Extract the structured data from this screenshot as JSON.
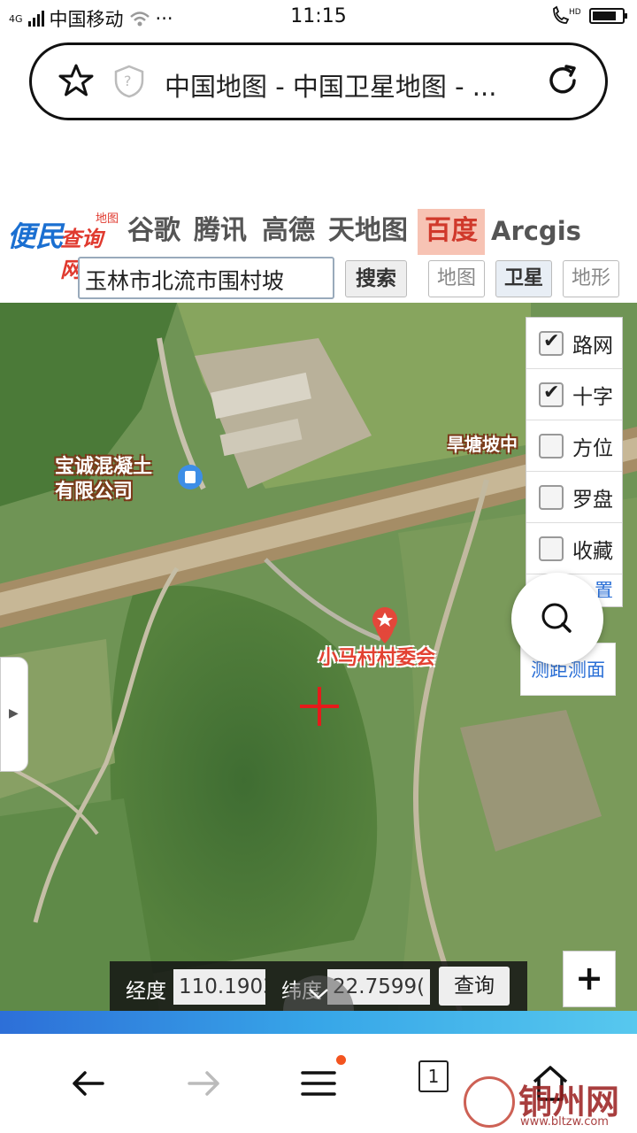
{
  "status_bar": {
    "network": "4G",
    "carrier": "中国移动",
    "more": "···",
    "time": "11:15",
    "hd": "HD",
    "battery_level": 0.8
  },
  "url_bar": {
    "title": "中国地图 - 中国卫星地图 - ..."
  },
  "site": {
    "logo_main": "便民",
    "logo_sub": "查询网",
    "logo_tag": "地图",
    "tabs": [
      "谷歌",
      "腾讯",
      "高德",
      "天地图",
      "百度",
      "Arcgis"
    ],
    "active_tab": "百度",
    "search_value": "玉林市北流市围村坡",
    "search_button": "搜索",
    "map_types": [
      "地图",
      "卫星",
      "地形"
    ],
    "active_map_type": "卫星"
  },
  "map": {
    "labels": {
      "company": "宝诚混凝土\n有限公司",
      "village_office": "小马村村委会",
      "top_right": "旱塘坡中"
    },
    "layers": [
      {
        "label": "路网",
        "checked": true
      },
      {
        "label": "十字",
        "checked": true
      },
      {
        "label": "方位",
        "checked": false
      },
      {
        "label": "罗盘",
        "checked": false
      },
      {
        "label": "收藏",
        "checked": false
      }
    ],
    "layer_extra": "置",
    "measure_label": "测距测面",
    "coords": {
      "lng_label": "经度",
      "lng_value": "110.1903",
      "lat_label": "纬度",
      "lat_value": "22.7599(",
      "query_label": "查询"
    },
    "zoom_in": "+"
  },
  "bottom_nav": {
    "tab_count": "1"
  },
  "watermark": {
    "name": "铜州网",
    "url": "www.bltzw.com"
  }
}
